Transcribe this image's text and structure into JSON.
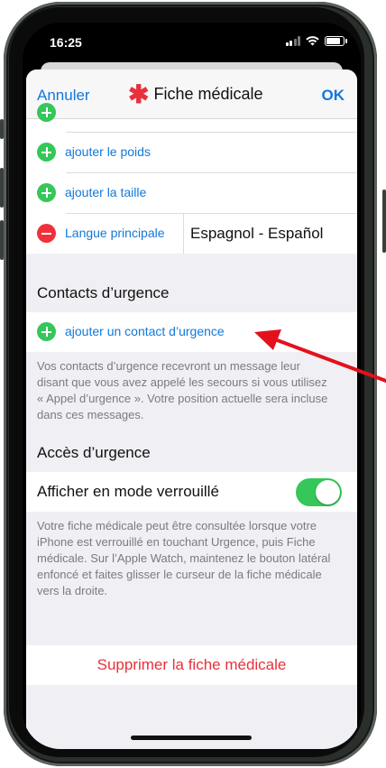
{
  "status_bar": {
    "time": "16:25"
  },
  "nav": {
    "cancel": "Annuler",
    "title": "Fiche médicale",
    "ok": "OK",
    "accent": "#1378d8",
    "star_color": "#e8303a"
  },
  "health_rows": [
    {
      "label": "ajouter le poids",
      "type": "add"
    },
    {
      "label": "ajouter la taille",
      "type": "add"
    }
  ],
  "language": {
    "label": "Langue principale",
    "value": "Espagnol - Español"
  },
  "emergency_contacts": {
    "header": "Contacts d’urgence",
    "add_label": "ajouter un contact d’urgence",
    "footer_lines": [
      "Vos contacts d’urgence recevront un message leur",
      "disant que vous avez appelé les secours si vous utilisez",
      "« Appel d’urgence ». Votre position actuelle sera incluse",
      "dans ces messages."
    ]
  },
  "emergency_access": {
    "header": "Accès d’urgence",
    "toggle_label": "Afficher en mode verrouillé",
    "toggle_on": true,
    "footer_lines": [
      "Votre fiche médicale peut être consultée lorsque votre",
      "iPhone est verrouillé en touchant Urgence, puis Fiche",
      "médicale. Sur l’Apple Watch, maintenez le bouton latéral",
      "enfoncé et faites glisser le curseur de la fiche médicale",
      "vers la droite."
    ]
  },
  "delete": {
    "label": "Supprimer la fiche médicale",
    "color": "#e8303a"
  },
  "annotation": {
    "arrow_color": "#e4101c"
  }
}
